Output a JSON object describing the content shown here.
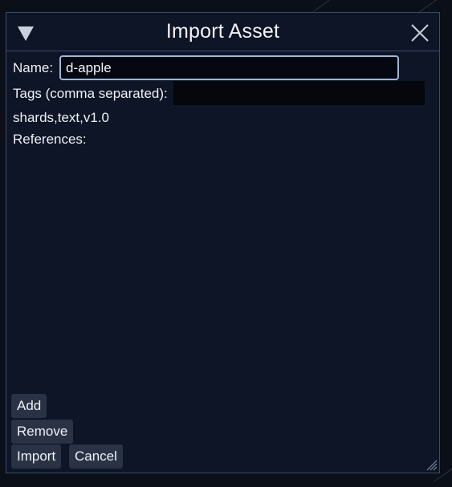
{
  "dialog": {
    "title": "Import Asset",
    "icons": {
      "collapse": "triangle-down-icon",
      "close": "close-icon",
      "resize": "resize-grip-icon"
    }
  },
  "form": {
    "name_label": "Name:",
    "name_value": "d-apple",
    "tags_label": "Tags (comma separated):",
    "tags_value": "",
    "tags_text": "shards,text,v1.0",
    "references_label": "References:"
  },
  "buttons": {
    "add": "Add",
    "remove": "Remove",
    "import": "Import",
    "cancel": "Cancel"
  },
  "colors": {
    "dialog_bg": "#0d1526",
    "border": "#3d4a66",
    "input_focus_border": "#9fb7d6",
    "button_bg": "#2a3346"
  }
}
